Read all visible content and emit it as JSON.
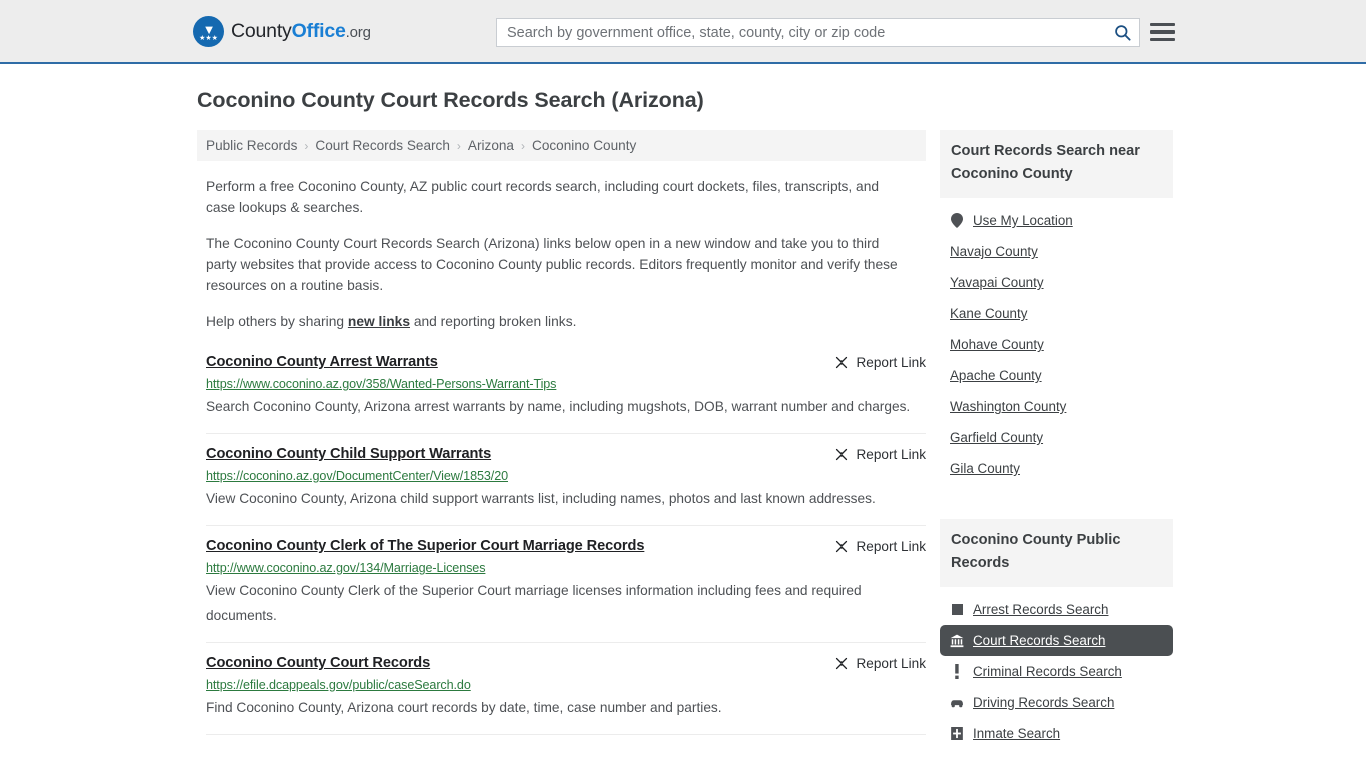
{
  "header": {
    "brand": {
      "part1": "County",
      "part2": "Office",
      "part3": ".org",
      "mark_eagle": "▼",
      "mark_stars": "★★★"
    },
    "search": {
      "value": "",
      "placeholder": "Search by government office, state, county, city or zip code"
    },
    "search_icon": "search-icon",
    "menu_icon": "hamburger-menu-icon"
  },
  "page_title": "Coconino County Court Records Search (Arizona)",
  "breadcrumb": {
    "separator": "›",
    "items": [
      {
        "label": "Public Records"
      },
      {
        "label": "Court Records Search"
      },
      {
        "label": "Arizona"
      },
      {
        "label": "Coconino County"
      }
    ]
  },
  "intro": {
    "p1": "Perform a free Coconino County, AZ public court records search, including court dockets, files, transcripts, and case lookups & searches.",
    "p2": "The Coconino County Court Records Search (Arizona) links below open in a new window and take you to third party websites that provide access to Coconino County public records. Editors frequently monitor and verify these resources on a routine basis.",
    "p3_before": "Help others by sharing ",
    "p3_link": "new links",
    "p3_after": " and reporting broken links."
  },
  "report_link_label": "Report Link",
  "results": [
    {
      "title": "Coconino County Arrest Warrants",
      "url": "https://www.coconino.az.gov/358/Wanted-Persons-Warrant-Tips",
      "description": "Search Coconino County, Arizona arrest warrants by name, including mugshots, DOB, warrant number and charges."
    },
    {
      "title": "Coconino County Child Support Warrants",
      "url": "https://coconino.az.gov/DocumentCenter/View/1853/20",
      "description": "View Coconino County, Arizona child support warrants list, including names, photos and last known addresses."
    },
    {
      "title": "Coconino County Clerk of The Superior Court Marriage Records",
      "url": "http://www.coconino.az.gov/134/Marriage-Licenses",
      "description": "View Coconino County Clerk of the Superior Court marriage licenses information including fees and required documents."
    },
    {
      "title": "Coconino County Court Records",
      "url": "https://efile.dcappeals.gov/public/caseSearch.do",
      "description": "Find Coconino County, Arizona court records by date, time, case number and parties."
    }
  ],
  "sidebar": {
    "near": {
      "heading": "Court Records Search near Coconino County",
      "items": [
        {
          "label": "Use My Location",
          "icon": "map-pin-icon"
        },
        {
          "label": "Navajo County",
          "icon": ""
        },
        {
          "label": "Yavapai County",
          "icon": ""
        },
        {
          "label": "Kane County",
          "icon": ""
        },
        {
          "label": "Mohave County",
          "icon": ""
        },
        {
          "label": "Apache County",
          "icon": ""
        },
        {
          "label": "Washington County",
          "icon": ""
        },
        {
          "label": "Garfield County",
          "icon": ""
        },
        {
          "label": "Gila County",
          "icon": ""
        }
      ]
    },
    "public_records": {
      "heading": "Coconino County Public Records",
      "items": [
        {
          "label": "Arrest Records Search",
          "icon": "fingerprint-square-icon",
          "active": false
        },
        {
          "label": "Court Records Search",
          "icon": "courthouse-icon",
          "active": true
        },
        {
          "label": "Criminal Records Search",
          "icon": "exclamation-icon",
          "active": false
        },
        {
          "label": "Driving Records Search",
          "icon": "car-icon",
          "active": false
        },
        {
          "label": "Inmate Search",
          "icon": "jail-icon",
          "active": false
        }
      ]
    }
  },
  "colors": {
    "header_bg": "#ededed",
    "header_border": "#2f6ca6",
    "brand_blue": "#1a7fd4",
    "url_green": "#2c7a3f",
    "active_bg": "#4b4f52",
    "panel_bg": "#f4f4f4"
  }
}
